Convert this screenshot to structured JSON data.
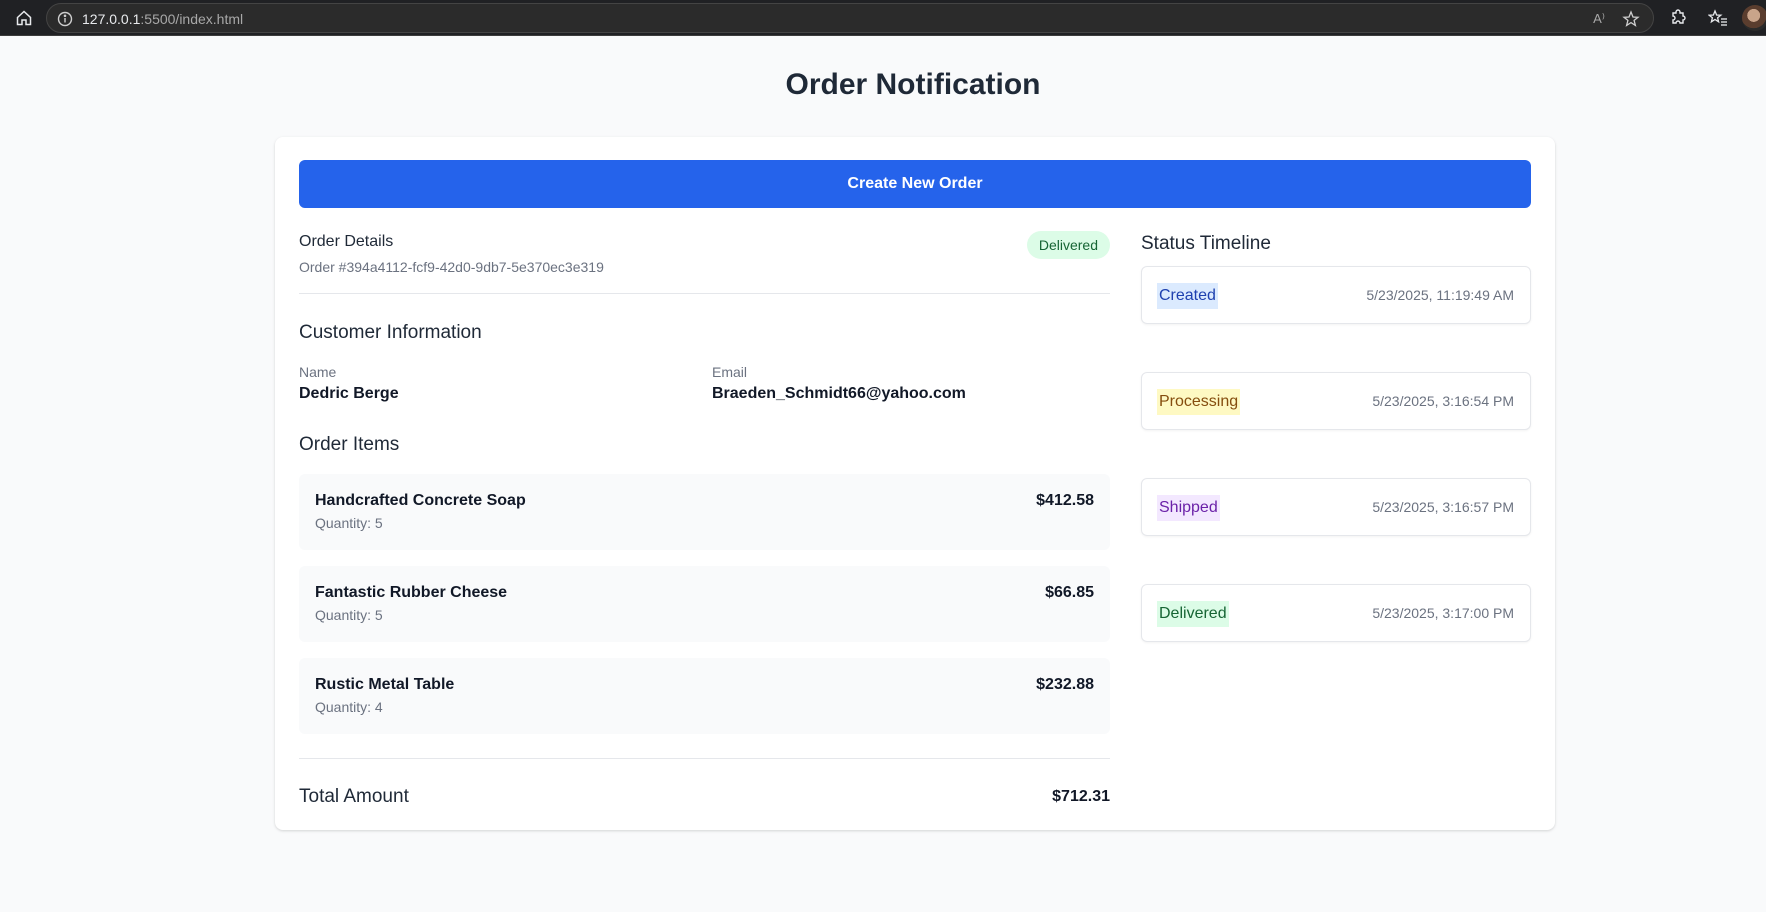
{
  "browser": {
    "url_host": "127.0.0.1",
    "url_rest": ":5500/index.html",
    "read_aloud": "A⁾"
  },
  "page": {
    "title": "Order Notification",
    "create_button": "Create New Order"
  },
  "order": {
    "details_title": "Order Details",
    "id_text": "Order #394a4112-fcf9-42d0-9db7-5e370ec3e319",
    "status": "Delivered",
    "status_color": "#166534",
    "status_bg": "#dcfce7"
  },
  "customer": {
    "heading": "Customer Information",
    "name_label": "Name",
    "name": "Dedric Berge",
    "email_label": "Email",
    "email": "Braeden_Schmidt66@yahoo.com"
  },
  "items": {
    "heading": "Order Items",
    "list": [
      {
        "name": "Handcrafted Concrete Soap",
        "quantity": "Quantity: 5",
        "price": "$412.58"
      },
      {
        "name": "Fantastic Rubber Cheese",
        "quantity": "Quantity: 5",
        "price": "$66.85"
      },
      {
        "name": "Rustic Metal Table",
        "quantity": "Quantity: 4",
        "price": "$232.88"
      }
    ]
  },
  "total": {
    "label": "Total Amount",
    "value": "$712.31"
  },
  "timeline": {
    "heading": "Status Timeline",
    "events": [
      {
        "status": "Created",
        "timestamp": "5/23/2025, 11:19:49 AM",
        "color": "#1e40af",
        "bg": "#dbeafe"
      },
      {
        "status": "Processing",
        "timestamp": "5/23/2025, 3:16:54 PM",
        "color": "#854d0e",
        "bg": "#fef9c3"
      },
      {
        "status": "Shipped",
        "timestamp": "5/23/2025, 3:16:57 PM",
        "color": "#6b21a8",
        "bg": "#f3e8ff"
      },
      {
        "status": "Delivered",
        "timestamp": "5/23/2025, 3:17:00 PM",
        "color": "#166534",
        "bg": "#dcfce7"
      }
    ]
  },
  "colors": {
    "accent": "#2563eb",
    "page_bg": "#f9fafb"
  }
}
